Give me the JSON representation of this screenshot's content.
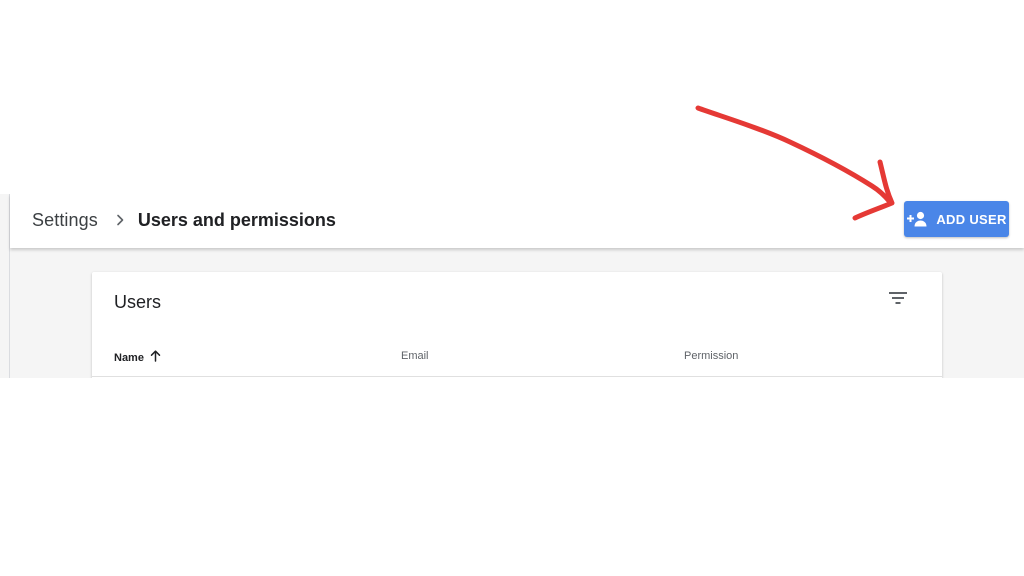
{
  "header": {
    "breadcrumb": {
      "root": "Settings",
      "current": "Users and permissions"
    },
    "add_user_button": {
      "label": "ADD USER",
      "icon": "person-add-icon"
    }
  },
  "card": {
    "title": "Users",
    "filter_icon": "filter-list-icon",
    "columns": [
      {
        "label": "Name",
        "sorted": "ascending",
        "icon": "arrow-up-icon"
      },
      {
        "label": "Email"
      },
      {
        "label": "Permission"
      }
    ]
  },
  "annotation": {
    "type": "hand-drawn-arrow",
    "color": "#e53935",
    "points_to": "add-user-button"
  },
  "colors": {
    "accent": "#4a86e8",
    "background": "#f5f5f5",
    "annotation": "#e53935"
  }
}
